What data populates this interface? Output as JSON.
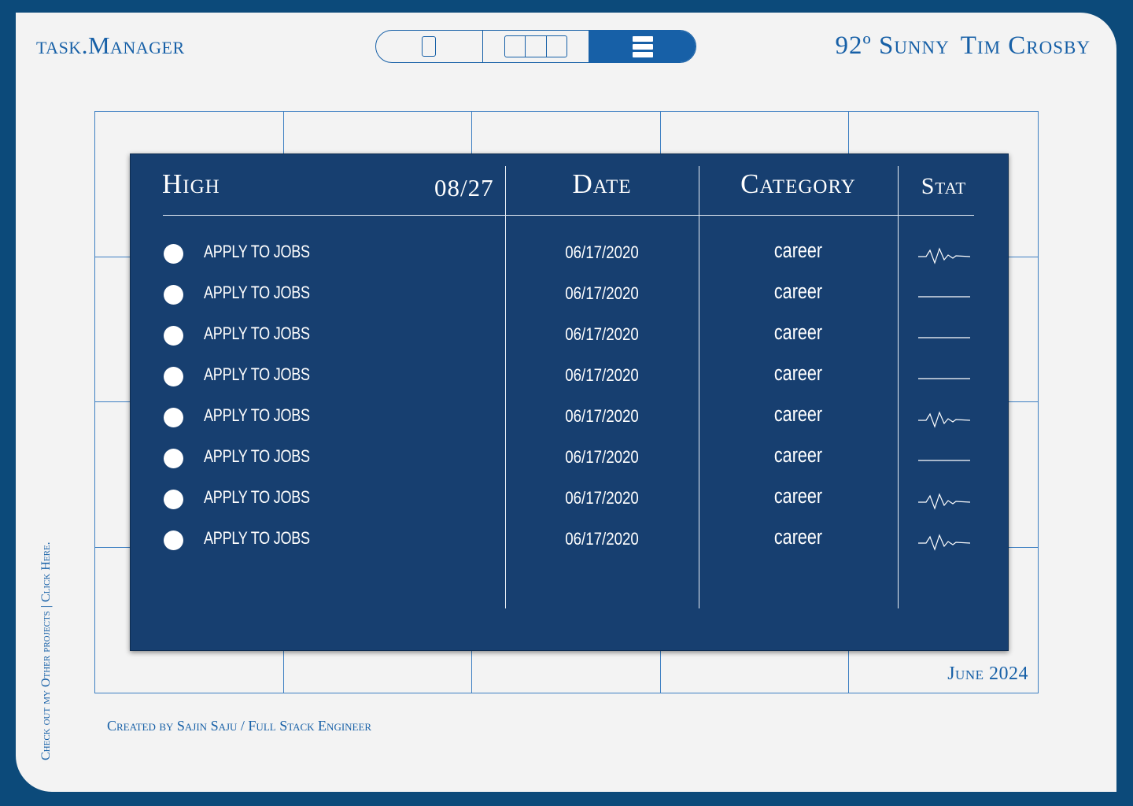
{
  "app": {
    "title": "task.Manager"
  },
  "header": {
    "weather": "92º Sunny",
    "user": "Tim Crosby"
  },
  "view_toggle": [
    {
      "name": "day-view",
      "icon": "day-view-icon"
    },
    {
      "name": "week-view",
      "icon": "week-view-icon"
    },
    {
      "name": "list-view",
      "icon": "list-view-icon",
      "active": true
    }
  ],
  "calendar": {
    "month_label": "June 2024"
  },
  "table": {
    "priority_label": "High",
    "header_date": "08/27",
    "columns": {
      "date": "Date",
      "category": "Category",
      "stat": "Stat"
    },
    "rows": [
      {
        "task": "APPLY TO JOBS",
        "date": "06/17/2020",
        "category": "career",
        "stat": "pulse-icon"
      },
      {
        "task": "APPLY TO JOBS",
        "date": "06/17/2020",
        "category": "career",
        "stat": "flat-line-icon"
      },
      {
        "task": "APPLY TO JOBS",
        "date": "06/17/2020",
        "category": "career",
        "stat": "flat-line-icon"
      },
      {
        "task": "APPLY TO JOBS",
        "date": "06/17/2020",
        "category": "career",
        "stat": "flat-line-icon"
      },
      {
        "task": "APPLY TO JOBS",
        "date": "06/17/2020",
        "category": "career",
        "stat": "pulse-icon"
      },
      {
        "task": "APPLY TO JOBS",
        "date": "06/17/2020",
        "category": "career",
        "stat": "flat-line-icon"
      },
      {
        "task": "APPLY TO JOBS",
        "date": "06/17/2020",
        "category": "career",
        "stat": "pulse-icon"
      },
      {
        "task": "APPLY TO JOBS",
        "date": "06/17/2020",
        "category": "career",
        "stat": "pulse-icon"
      }
    ]
  },
  "footer": {
    "credit": "Created by Sajin Saju / Full Stack Engineer",
    "side_link": "Check out my Other projects | Click Here."
  },
  "colors": {
    "page_border": "#0c4a7a",
    "panel": "#173f70",
    "accent": "#1760a7",
    "background": "#f3f3f3"
  }
}
